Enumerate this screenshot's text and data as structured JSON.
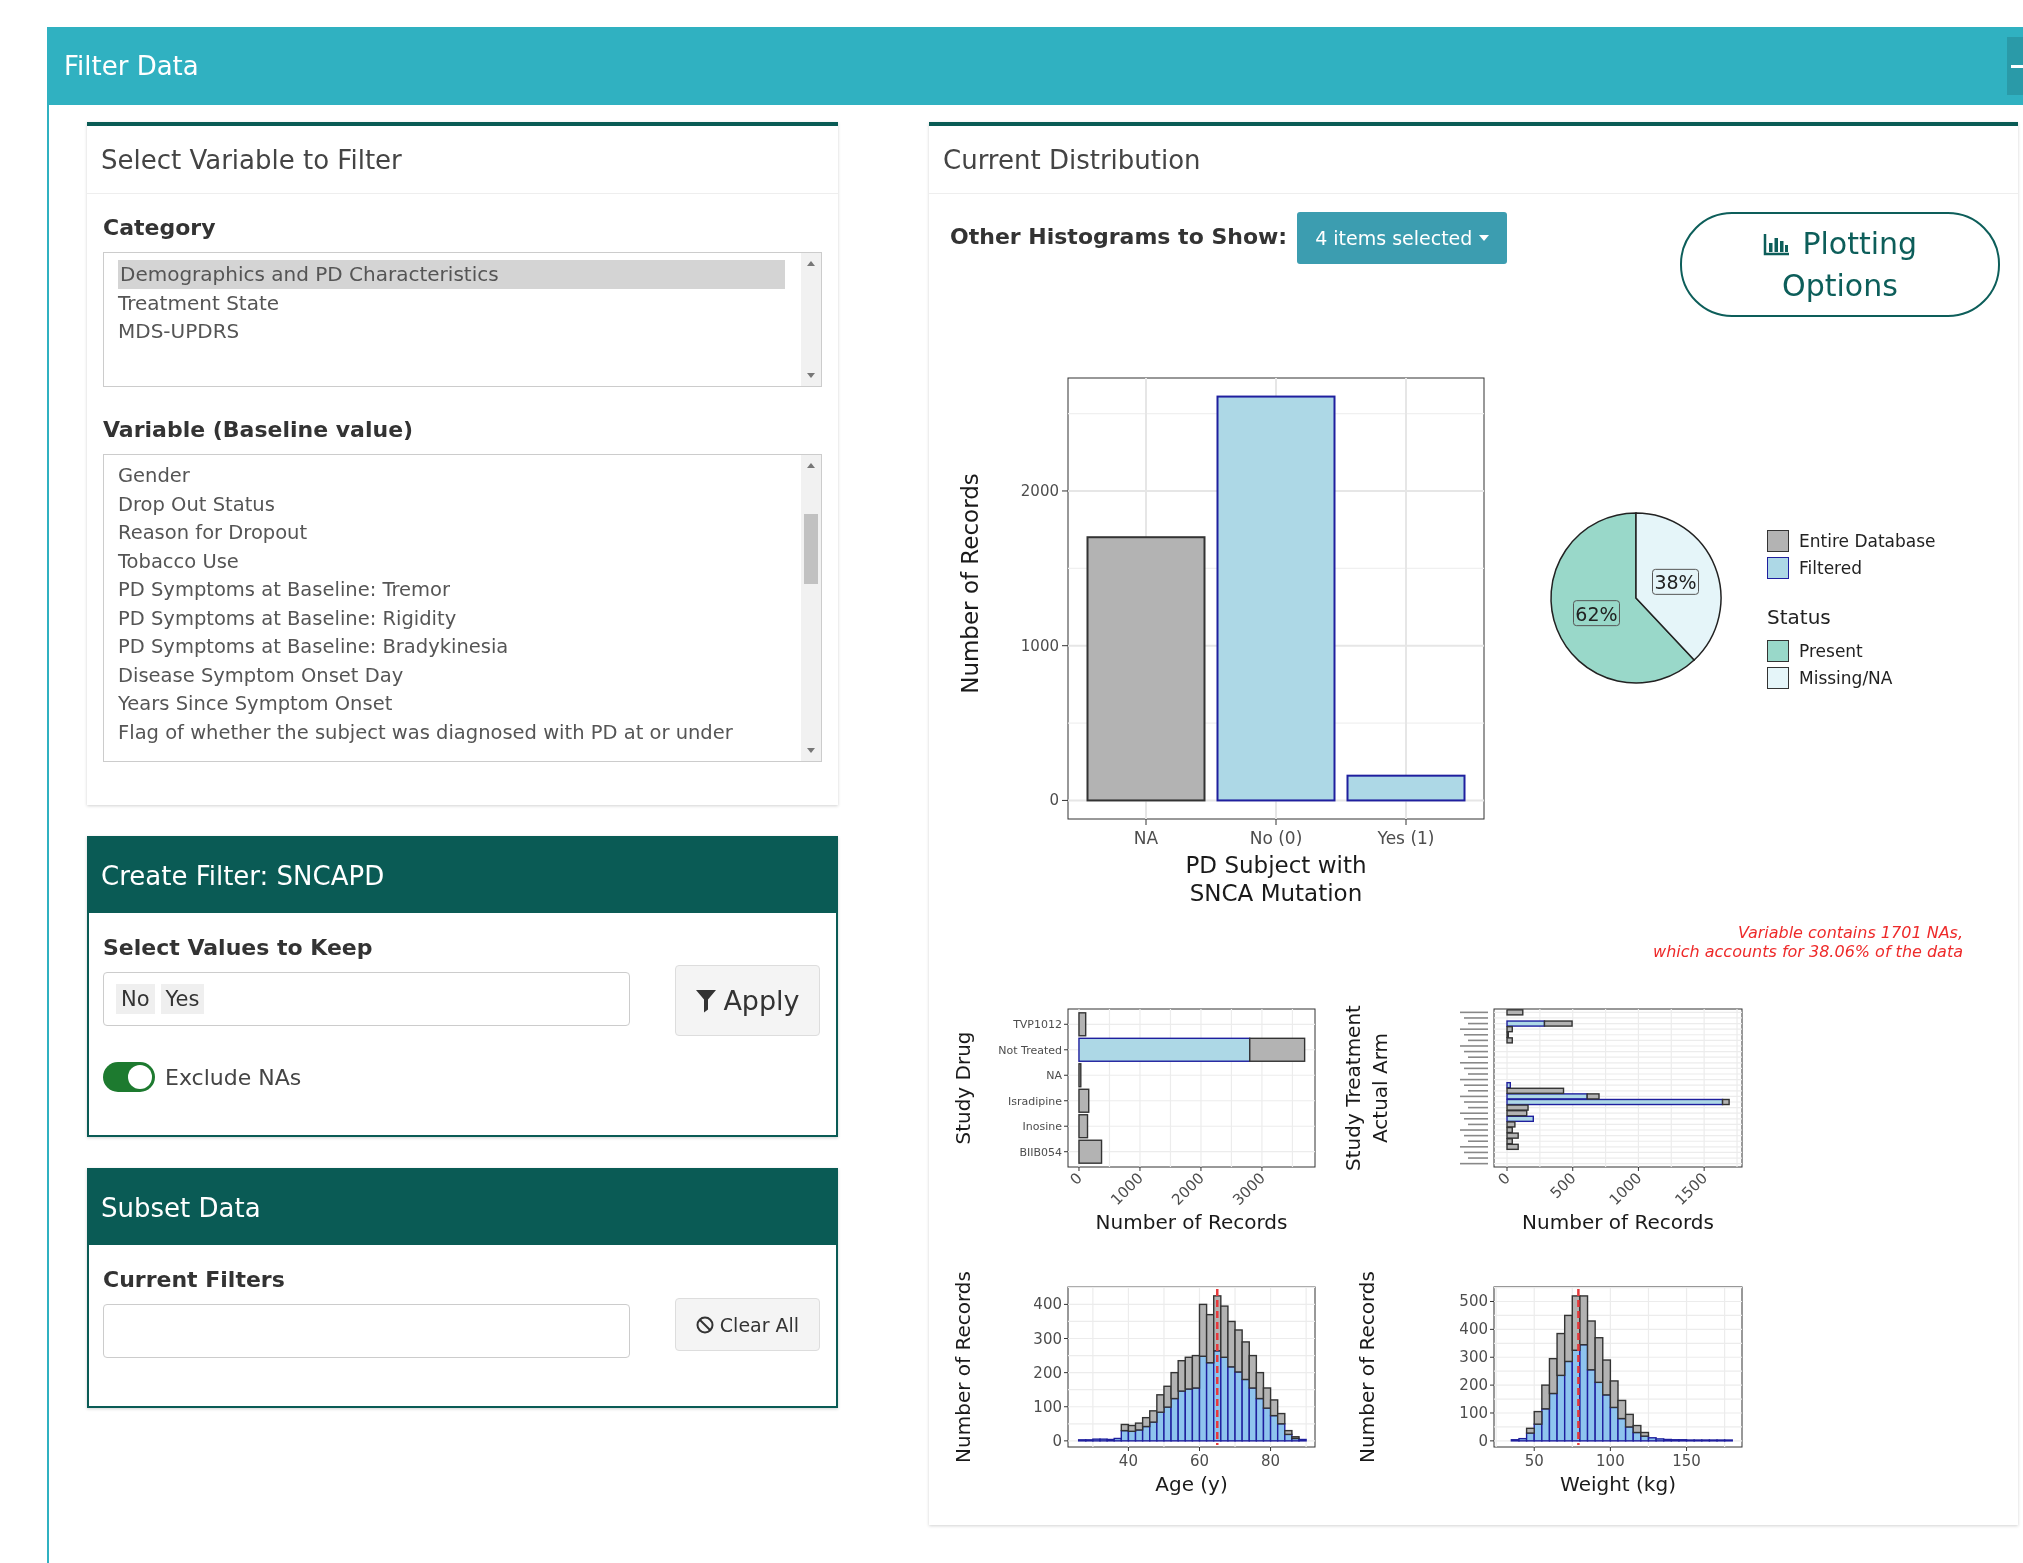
{
  "header": {
    "title": "Filter Data"
  },
  "select_variable": {
    "title": "Select Variable to Filter",
    "category_label": "Category",
    "categories": [
      {
        "label": "Demographics and PD Characteristics",
        "selected": true
      },
      {
        "label": "Treatment State",
        "selected": false
      },
      {
        "label": "MDS-UPDRS",
        "selected": false
      }
    ],
    "variable_label": "Variable (Baseline value)",
    "variables": [
      {
        "label": "Gender",
        "selected": false
      },
      {
        "label": "Drop Out Status",
        "selected": false
      },
      {
        "label": "Reason for Dropout",
        "selected": false
      },
      {
        "label": "Tobacco Use",
        "selected": false
      },
      {
        "label": "PD Symptoms at Baseline: Tremor",
        "selected": false
      },
      {
        "label": "PD Symptoms at Baseline: Rigidity",
        "selected": false
      },
      {
        "label": "PD Symptoms at Baseline: Bradykinesia",
        "selected": false
      },
      {
        "label": "Disease Symptom Onset Day",
        "selected": false
      },
      {
        "label": "Years Since Symptom Onset",
        "selected": false
      },
      {
        "label": "Flag of whether the subject was diagnosed with PD at or under",
        "selected": false
      }
    ]
  },
  "create_filter": {
    "title": "Create Filter: SNCAPD",
    "values_label": "Select Values to Keep",
    "values": [
      "No",
      "Yes"
    ],
    "apply_button": "Apply",
    "exclude_nas": {
      "label": "Exclude NAs",
      "on": true
    }
  },
  "subset_data": {
    "title": "Subset Data",
    "filters_label": "Current Filters",
    "clear_button": "Clear All"
  },
  "distribution": {
    "title": "Current Distribution",
    "histograms_label": "Other Histograms to Show:",
    "histograms_dropdown": "4 items selected",
    "plotting_button": "Plotting Options",
    "main_chart": {
      "chart_data": {
        "type": "bar",
        "grid": true,
        "xlabel": "PD Subject with\nSNCA Mutation",
        "ylabel": "Number of Records",
        "categories": [
          "NA",
          "No (0)",
          "Yes (1)"
        ],
        "series": [
          {
            "name": "Entire Database",
            "color": "#b3b3b3",
            "values": [
              1701,
              null,
              null
            ]
          },
          {
            "name": "Filtered",
            "color": "#add8e6",
            "values": [
              null,
              2610,
              160
            ]
          }
        ],
        "ylim": [
          -120,
          2730
        ],
        "yticks": [
          0,
          1000,
          2000
        ]
      }
    },
    "pie_chart": {
      "chart_data": {
        "type": "pie",
        "categories": [
          "Present",
          "Missing/NA"
        ],
        "series": [
          {
            "name": "Status",
            "values": [
              62,
              38
            ]
          }
        ],
        "value_labels": [
          "62%",
          "38%"
        ]
      }
    },
    "pie_colors": [
      {
        "color": "#99d8c9"
      },
      {
        "color": "#e5f5f9"
      }
    ],
    "na_note": [
      "Variable contains 1701 NAs,",
      "which accounts for 38.06% of the data"
    ],
    "small_charts": [
      {
        "chart_data": {
          "type": "bar",
          "stacked": true,
          "grid": true,
          "orientation": "horizontal",
          "xlabel": "Number of Records",
          "ylabel": "Study Drug",
          "categories": [
            "TVP1012",
            "Not Treated",
            "NA",
            "Isradipine",
            "Inosine",
            "BIIB054"
          ],
          "series": [
            {
              "color": "#b3b3b3",
              "values": [
                110,
                900,
                30,
                160,
                140,
                370
              ]
            },
            {
              "color": "#add8e6",
              "values": [
                null,
                2800,
                null,
                null,
                null,
                null
              ]
            }
          ],
          "xlim": [
            -180,
            3870
          ],
          "xticks": [
            0,
            1000,
            2000,
            3000
          ]
        }
      },
      {
        "chart_data": {
          "type": "bar",
          "stacked": true,
          "grid": true,
          "orientation": "horizontal",
          "xlabel": "Number of Records",
          "ylabel": "Study Treatment\nActual Arm",
          "series": [
            {
              "color": "#b3b3b3",
              "values": [
                120,
                null,
                210,
                40,
                10,
                40,
                null,
                null,
                null,
                null,
                null,
                null,
                null,
                null,
                430,
                90,
                50,
                160,
                150,
                null,
                60,
                40,
                85,
                40,
                85,
                null,
                null,
                null
              ]
            },
            {
              "color": "#add8e6",
              "values": [
                null,
                null,
                285,
                null,
                null,
                null,
                null,
                null,
                null,
                null,
                null,
                null,
                null,
                25,
                null,
                610,
                1640,
                null,
                null,
                200,
                null,
                null,
                null,
                null,
                null,
                null,
                null,
                null
              ]
            }
          ],
          "xlim": [
            -99,
            1788
          ],
          "xticks": [
            0,
            500,
            1000,
            1500
          ]
        }
      },
      {
        "chart_data": {
          "type": "bar",
          "stacked": true,
          "grid": true,
          "xlabel": "Age (y)",
          "ylabel": "Number of Records",
          "x": [
            27,
            29,
            31,
            33,
            35,
            37,
            39,
            41,
            43,
            45,
            47,
            49,
            51,
            53,
            55,
            57,
            59,
            61,
            63,
            65,
            67,
            69,
            71,
            73,
            75,
            77,
            79,
            81,
            83,
            85,
            87,
            89
          ],
          "series": [
            {
              "color": "#b3b3b3",
              "values": [
                null,
                null,
                null,
                null,
                null,
                null,
                18,
                17,
                20,
                26,
                33,
                51,
                61,
                76,
                89,
                93,
                95,
                152,
                141,
                161,
                150,
                133,
                123,
                110,
                95,
                76,
                59,
                46,
                30,
                11,
                5,
                null
              ]
            },
            {
              "color": "#8ec4ee",
              "values": [
                3,
                3,
                5,
                5,
                4,
                7,
                30,
                28,
                32,
                42,
                55,
                84,
                99,
                124,
                146,
                152,
                155,
                248,
                229,
                264,
                245,
                217,
                202,
                180,
                155,
                124,
                96,
                74,
                50,
                19,
                7,
                4
              ]
            }
          ],
          "xlim": [
            23,
            92.5
          ],
          "ylim": [
            -18,
            451
          ],
          "xticks": [
            40,
            60,
            80
          ],
          "yticks": [
            0,
            100,
            200,
            300,
            400
          ],
          "ref_lines": [
            {
              "axis": "x",
              "value": 65,
              "color": "#e8393b"
            }
          ]
        }
      },
      {
        "chart_data": {
          "type": "bar",
          "stacked": true,
          "grid": true,
          "xlabel": "Weight (kg)",
          "ylabel": "Number of Records",
          "x": [
            37.5,
            42.5,
            47.5,
            52.5,
            57.5,
            62.5,
            67.5,
            72.5,
            77.5,
            82.5,
            87.5,
            92.5,
            97.5,
            102.5,
            107.5,
            112.5,
            117.5,
            122.5,
            127.5,
            132.5,
            137.5,
            142.5,
            147.5,
            152.5,
            157.5,
            162.5,
            167.5,
            172.5,
            177.5
          ],
          "series": [
            {
              "color": "#b3b3b3",
              "values": [
                null,
                null,
                17,
                45,
                85,
                125,
                150,
                165,
                195,
                175,
                175,
                160,
                125,
                95,
                65,
                45,
                25,
                13,
                null,
                null,
                null,
                null,
                null,
                null,
                null,
                null,
                null,
                null,
                null
              ]
            },
            {
              "color": "#8ec4ee",
              "values": [
                4,
                8,
                28,
                60,
                115,
                170,
                235,
                285,
                325,
                345,
                255,
                210,
                165,
                120,
                80,
                50,
                30,
                17,
                11,
                7,
                5,
                4,
                4,
                3,
                3,
                3,
                3,
                3,
                3
              ]
            }
          ],
          "xlim": [
            23.6,
            186.4
          ],
          "ylim": [
            -22,
            552
          ],
          "xticks": [
            50,
            100,
            150
          ],
          "yticks": [
            0,
            100,
            200,
            300,
            400,
            500
          ],
          "ref_lines": [
            {
              "axis": "x",
              "value": 79,
              "color": "#e8393b"
            }
          ]
        }
      }
    ]
  }
}
